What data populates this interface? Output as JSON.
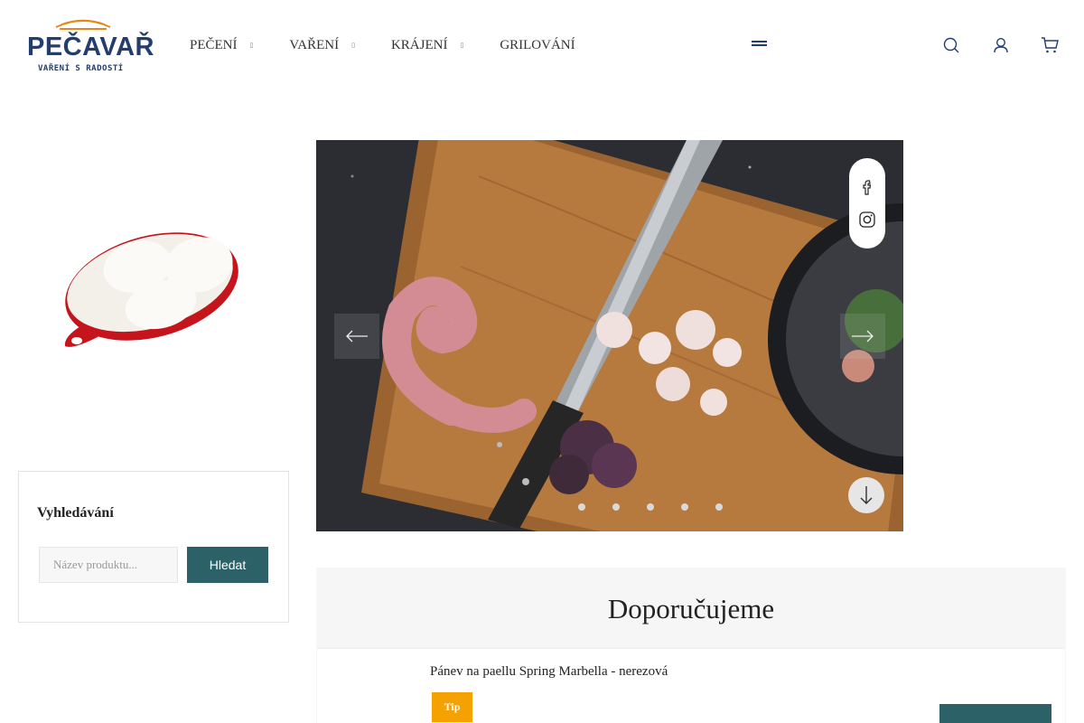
{
  "header": {
    "logo": {
      "name": "PEČAVAŘ",
      "tagline": "VAŘENÍ S RADOSTÍ"
    },
    "nav": [
      {
        "label": "PEČENÍ",
        "has_dropdown": true
      },
      {
        "label": "VAŘENÍ",
        "has_dropdown": true
      },
      {
        "label": "KRÁJENÍ",
        "has_dropdown": true
      },
      {
        "label": "GRILOVÁNÍ",
        "has_dropdown": false
      }
    ],
    "caret_glyph": "▯",
    "icons": [
      "menu-icon",
      "search-icon",
      "user-icon",
      "cart-icon"
    ],
    "brand_color": "#233e6e"
  },
  "sidebar": {
    "search": {
      "title": "Vyhledávání",
      "placeholder": "Název produktu...",
      "button_label": "Hledat"
    }
  },
  "hero": {
    "slide_count": 5,
    "active_slide": 1,
    "social": [
      "facebook-icon",
      "instagram-icon"
    ]
  },
  "recommended": {
    "title": "Doporučujeme",
    "items": [
      {
        "name": "Pánev na paellu Spring Marbella - nerezová",
        "badge": "Tip"
      }
    ]
  },
  "colors": {
    "accent": "#2d6168",
    "badge": "#f5a200"
  }
}
